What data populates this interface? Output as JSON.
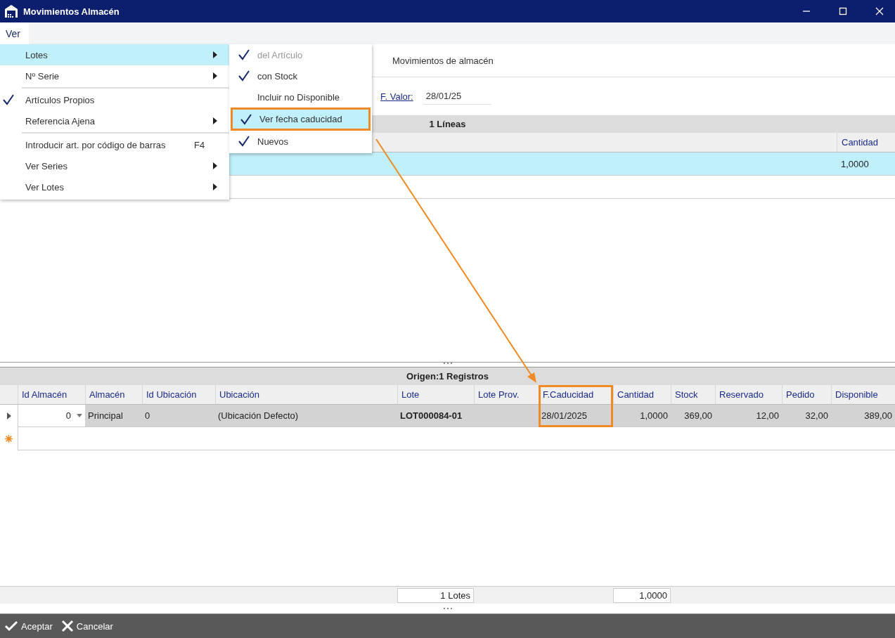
{
  "window": {
    "title": "Movimientos Almacén"
  },
  "menu_bar": [
    {
      "label": "Ver",
      "selected": true
    }
  ],
  "menu": {
    "items": [
      {
        "label": "Lotes",
        "checked": false,
        "submenu": true,
        "selected": true,
        "separator_before": false
      },
      {
        "label": "Nº Serie",
        "checked": false,
        "submenu": true,
        "selected": false,
        "separator_before": false
      },
      {
        "label": "Artículos Propios",
        "checked": true,
        "submenu": false,
        "selected": false,
        "separator_before": true
      },
      {
        "label": "Referencia Ajena",
        "checked": false,
        "submenu": true,
        "selected": false,
        "separator_before": false
      },
      {
        "label": "Introducir art. por código de barras",
        "shortcut": "F4",
        "checked": false,
        "submenu": false,
        "selected": false,
        "separator_before": true
      },
      {
        "label": "Ver Series",
        "checked": false,
        "submenu": true,
        "selected": false,
        "separator_before": false
      },
      {
        "label": "Ver Lotes",
        "checked": false,
        "submenu": true,
        "selected": false,
        "separator_before": false
      }
    ]
  },
  "submenu": {
    "items": [
      {
        "label": "del Artículo",
        "checked": true,
        "disabled": true,
        "selected": false,
        "highlighted": false
      },
      {
        "label": "con Stock",
        "checked": true,
        "disabled": false,
        "selected": false,
        "highlighted": false
      },
      {
        "label": "Incluir no Disponible",
        "checked": false,
        "disabled": false,
        "selected": false,
        "highlighted": false
      },
      {
        "label": "Ver fecha caducidad",
        "checked": true,
        "disabled": false,
        "selected": true,
        "highlighted": true
      },
      {
        "label": "Nuevos",
        "checked": true,
        "disabled": false,
        "selected": false,
        "highlighted": false
      }
    ]
  },
  "header": {
    "title": "Movimientos de almacén"
  },
  "form": {
    "label": "F. Valor:",
    "value": "28/01/25"
  },
  "lines_grid": {
    "title": "1 Líneas",
    "columns": [
      "Cantidad"
    ],
    "rows": [
      {
        "selected": true,
        "cells": [
          "1,0000"
        ]
      }
    ]
  },
  "origin_grid": {
    "title": "Origen:1 Registros",
    "columns": [
      {
        "label": "Id Almacén",
        "kind": "combo",
        "highlighted": false
      },
      {
        "label": "Almacén",
        "kind": "text",
        "highlighted": false
      },
      {
        "label": "Id Ubicación",
        "kind": "text",
        "highlighted": false
      },
      {
        "label": "Ubicación",
        "kind": "text",
        "highlighted": false
      },
      {
        "label": "Lote",
        "kind": "code",
        "highlighted": false
      },
      {
        "label": "Lote Prov.",
        "kind": "text",
        "highlighted": false
      },
      {
        "label": "F.Caducidad",
        "kind": "text",
        "highlighted": true
      },
      {
        "label": "Cantidad",
        "kind": "number",
        "highlighted": false
      },
      {
        "label": "Stock",
        "kind": "number",
        "highlighted": false
      },
      {
        "label": "Reservado",
        "kind": "number",
        "highlighted": false
      },
      {
        "label": "Pedido",
        "kind": "number",
        "highlighted": false
      },
      {
        "label": "Disponible",
        "kind": "number",
        "highlighted": false
      }
    ],
    "rows": [
      {
        "selected": true,
        "cells": [
          "0",
          "Principal",
          "0",
          "(Ubicación Defecto)",
          "LOT000084-01",
          "",
          "28/01/2025",
          "1,0000",
          "369,00",
          "12,00",
          "32,00",
          "389,00"
        ]
      }
    ],
    "new_row": true
  },
  "totals": {
    "lots": "1 Lotes",
    "quantity": "1,0000"
  },
  "buttons": [
    {
      "label": "Aceptar",
      "kind": "accept"
    },
    {
      "label": "Cancelar",
      "kind": "cancel"
    }
  ]
}
